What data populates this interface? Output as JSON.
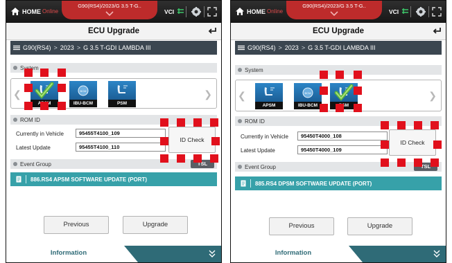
{
  "colors": {
    "marker_red": "#e1101c",
    "teal": "#37a1a9",
    "dark_teal": "#2f6b77",
    "vehicle_tab": "#bd2b2b"
  },
  "panels": [
    {
      "home_label": "HOME",
      "online_label": "Online",
      "vehicle_title": "G90(RS4)/2023/G 3.5 T-G..",
      "vci_label": "VCI",
      "page_title": "ECU Upgrade",
      "breadcrumb": [
        "G90(RS4)",
        "2023",
        "G 3.5 T-GDI LAMBDA III"
      ],
      "system_label": "System",
      "modules": [
        {
          "label": "APSM",
          "icon": "seat-memory-icon",
          "checked": true
        },
        {
          "label": "IBU-BCM",
          "icon": "bcm-module-icon",
          "checked": false
        },
        {
          "label": "PSM",
          "icon": "seat-memory-icon",
          "checked": false
        }
      ],
      "rom_label": "ROM ID",
      "currently_label": "Currently in Vehicle",
      "current_value": "95455T4100_109",
      "latest_label": "Latest Update",
      "latest_value": "95455T4100_110",
      "id_check_label": "ID Check",
      "event_label": "Event Group",
      "tsl_label": "TSL",
      "event_item": "886.RS4 APSM SOFTWARE UPDATE (PORT)",
      "previous_label": "Previous",
      "upgrade_label": "Upgrade",
      "info_label": "Information"
    },
    {
      "home_label": "HOME",
      "online_label": "Online",
      "vehicle_title": "G90(RS4)/2023/G 3.5 T-G..",
      "vci_label": "VCI",
      "page_title": "ECU Upgrade",
      "breadcrumb": [
        "G90(RS4)",
        "2023",
        "G 3.5 T-GDI LAMBDA III"
      ],
      "system_label": "System",
      "modules": [
        {
          "label": "APSM",
          "icon": "seat-memory-icon",
          "checked": false
        },
        {
          "label": "IBU-BCM",
          "icon": "bcm-module-icon",
          "checked": false
        },
        {
          "label": "PSM",
          "icon": "seat-memory-icon",
          "checked": true
        }
      ],
      "rom_label": "ROM ID",
      "currently_label": "Currently in Vehicle",
      "current_value": "95450T4000_108",
      "latest_label": "Latest Update",
      "latest_value": "95450T4000_109",
      "id_check_label": "ID Check",
      "event_label": "Event Group",
      "tsl_label": "TSL",
      "event_item": "885.RS4 DPSM SOFTWARE UPDATE (PORT)",
      "previous_label": "Previous",
      "upgrade_label": "Upgrade",
      "info_label": "Information"
    }
  ]
}
